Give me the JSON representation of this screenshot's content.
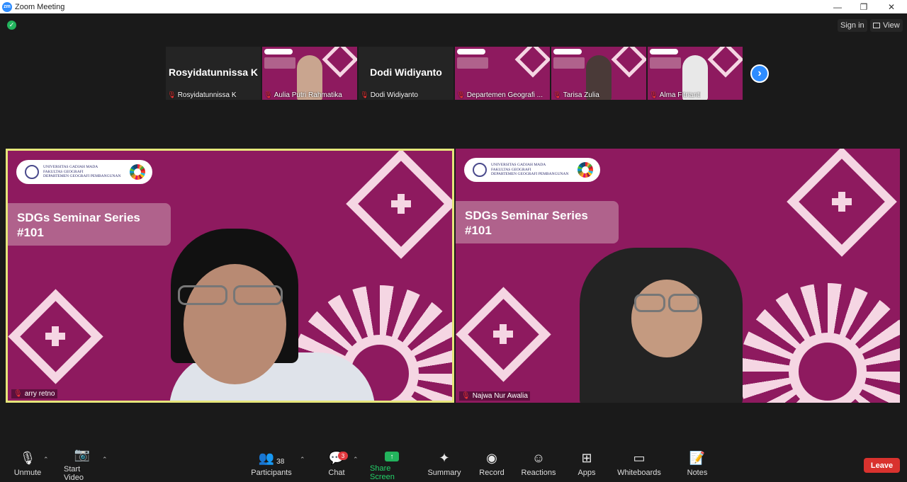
{
  "window": {
    "title": "Zoom Meeting",
    "logo_text": "zm",
    "minimize": "—",
    "restore": "❐",
    "close": "✕"
  },
  "top_right": {
    "sign_in": "Sign in",
    "view": "View"
  },
  "thumbnails": [
    {
      "name": "Rosyidatunnissa K",
      "label": "Rosyidatunnissa K",
      "video": false
    },
    {
      "name": "",
      "label": "Aulia Putri Rahmatika",
      "video": true
    },
    {
      "name": "Dodi Widiyanto",
      "label": "Dodi Widiyanto",
      "video": false
    },
    {
      "name": "",
      "label": "Departemen Geografi ...",
      "video": true
    },
    {
      "name": "",
      "label": "Tarisa Zulia",
      "video": true
    },
    {
      "name": "",
      "label": "Alma Fitrianti",
      "video": true
    }
  ],
  "slide": {
    "university": "UNIVERSITAS GADJAH MADA",
    "faculty": "FAKULTAS GEOGRAFI",
    "department": "DEPARTEMEN GEOGRAFI PEMBANGUNAN",
    "title_line1": "SDGs Seminar Series",
    "title_line2": "#101"
  },
  "main_tiles": [
    {
      "label": "arry retno",
      "active": true
    },
    {
      "label": "Najwa Nur Awalia",
      "active": false
    }
  ],
  "toolbar": {
    "unmute": "Unmute",
    "start_video": "Start Video",
    "participants": "Participants",
    "participants_count": "38",
    "chat": "Chat",
    "chat_badge": "3",
    "share_screen": "Share Screen",
    "summary": "Summary",
    "record": "Record",
    "reactions": "Reactions",
    "apps": "Apps",
    "whiteboards": "Whiteboards",
    "notes": "Notes",
    "leave": "Leave"
  },
  "colors": {
    "slide_bg": "#8e1a5f",
    "pattern": "#f5d6e3",
    "accent_blue": "#2d8cff",
    "leave_red": "#d9322e",
    "active_border": "#e6e67a",
    "share_green": "#23b35d"
  }
}
